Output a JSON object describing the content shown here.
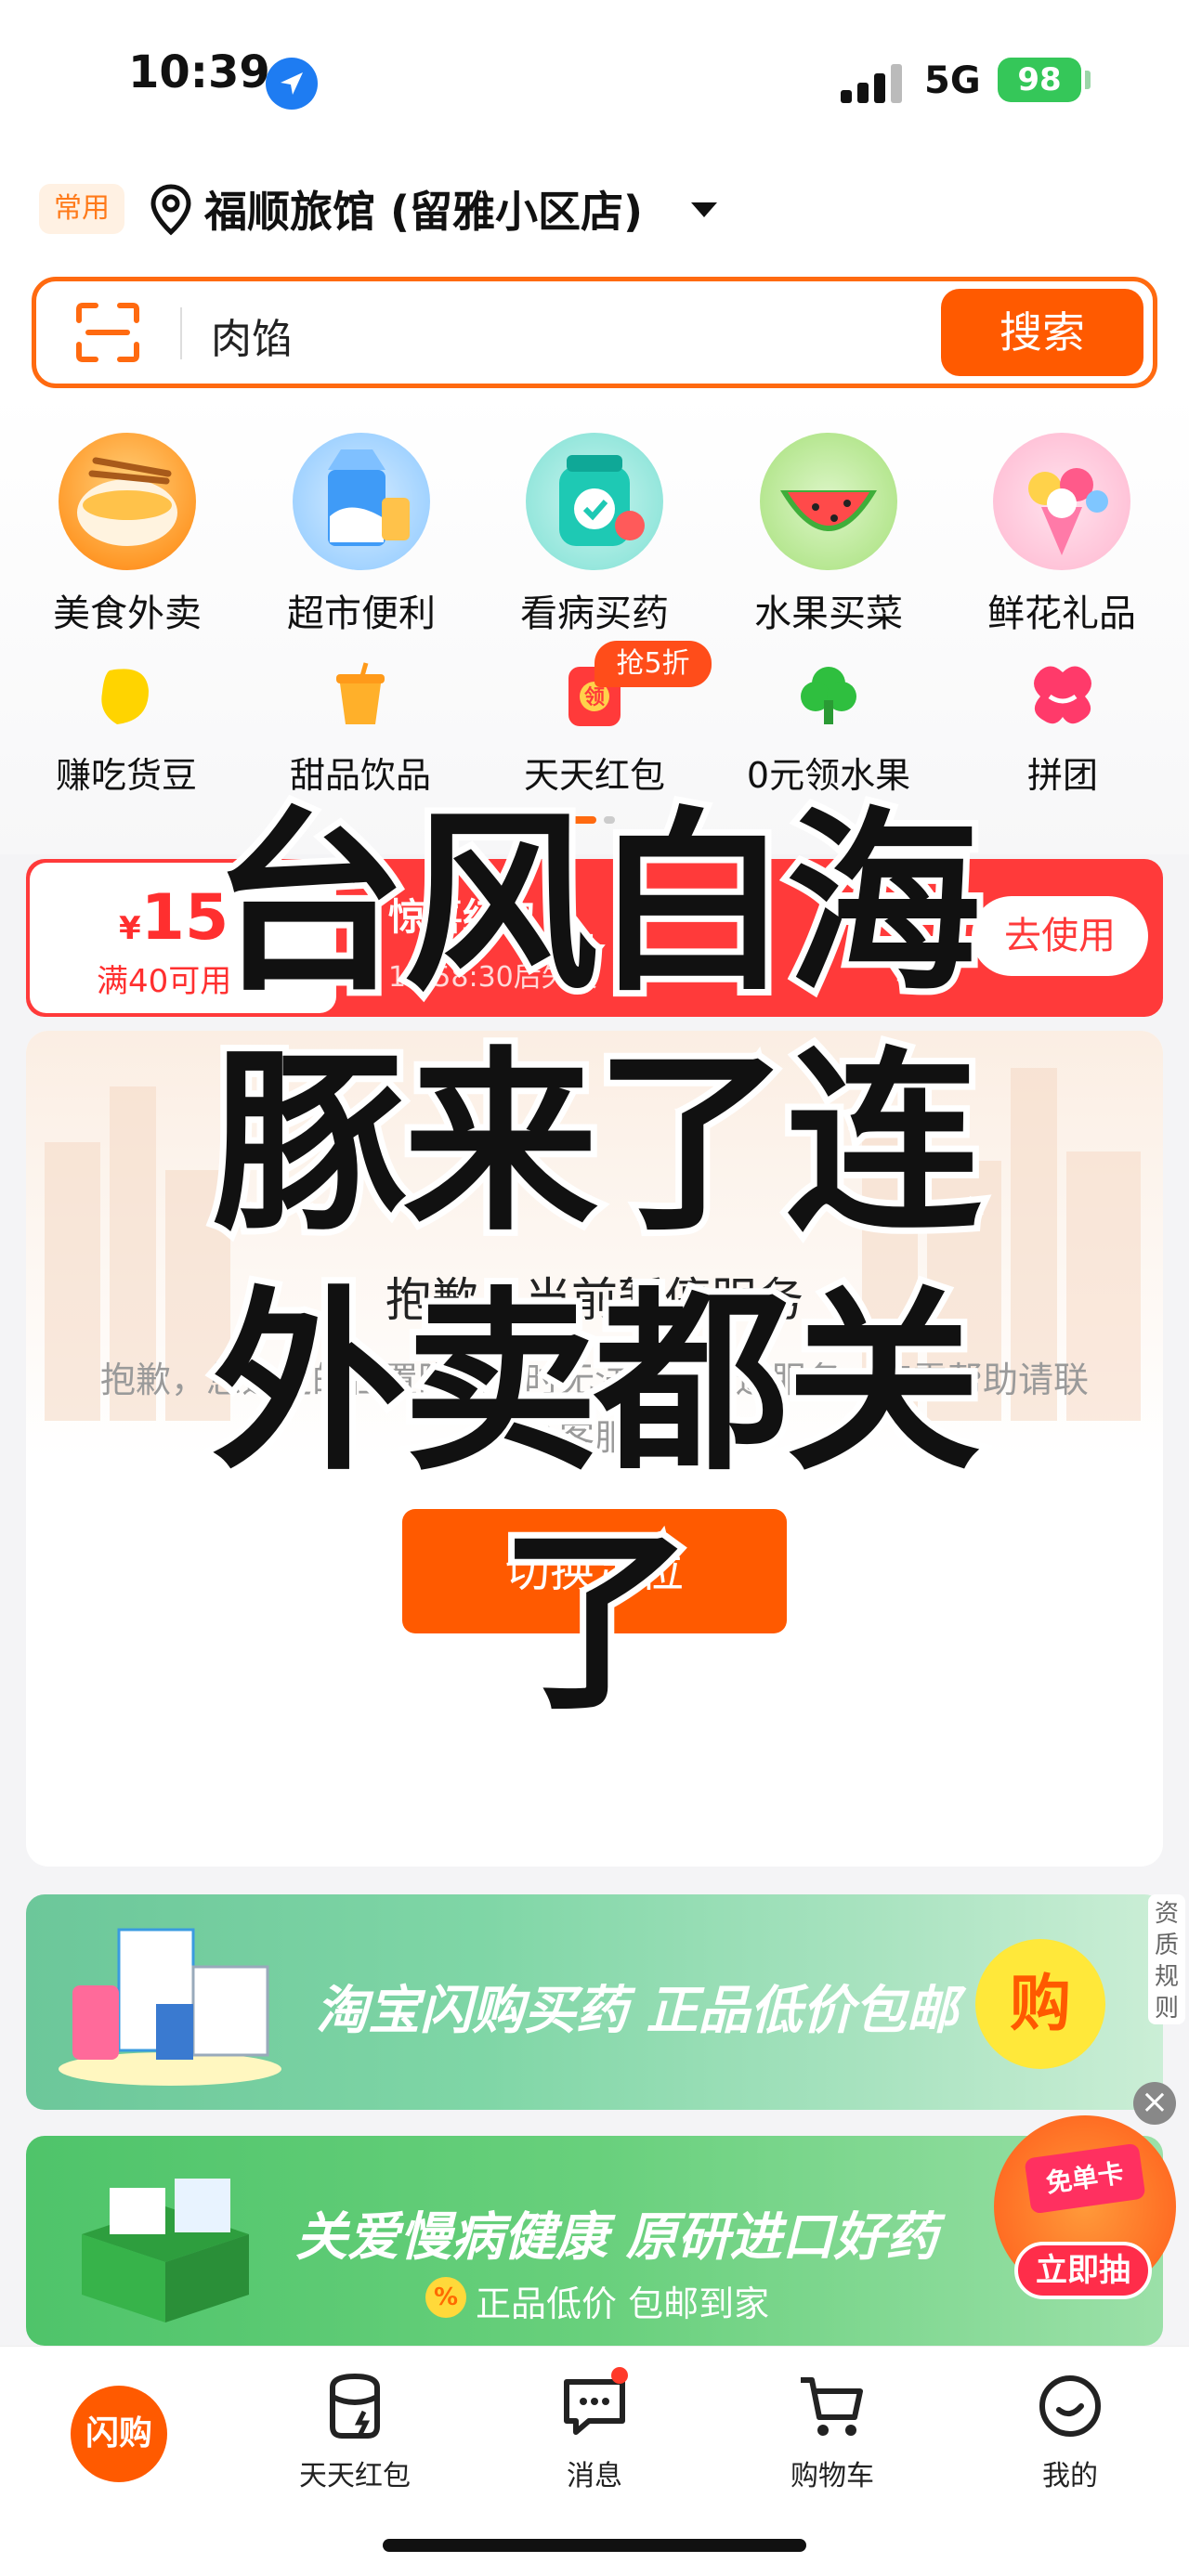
{
  "status_bar": {
    "time": "10:39",
    "network": "5G",
    "battery": "98"
  },
  "location": {
    "tag": "常用",
    "address": "福顺旅馆 (留雅小区店)"
  },
  "search": {
    "query": "肉馅",
    "button": "搜索"
  },
  "categories_main": [
    {
      "label": "美食外卖",
      "icon": "noodle-bowl-icon"
    },
    {
      "label": "超市便利",
      "icon": "milk-carton-icon"
    },
    {
      "label": "看病买药",
      "icon": "medicine-jar-icon"
    },
    {
      "label": "水果买菜",
      "icon": "watermelon-icon"
    },
    {
      "label": "鲜花礼品",
      "icon": "flower-bouquet-icon"
    }
  ],
  "categories_secondary": [
    {
      "label": "赚吃货豆",
      "icon": "bean-icon"
    },
    {
      "label": "甜品饮品",
      "icon": "drink-cup-icon"
    },
    {
      "label": "天天红包",
      "icon": "red-packet-icon"
    },
    {
      "label": "0元领水果",
      "icon": "tree-icon"
    },
    {
      "label": "拼团",
      "icon": "group-icon"
    }
  ],
  "sale_badge": "抢5折",
  "coupon": {
    "currency": "¥",
    "amount": "15",
    "condition": "满40可用",
    "title": "惊喜红包",
    "subtitle": "13:58:30后失效",
    "use_button": "去使用"
  },
  "service": {
    "title": "抱歉，当前暂停服务",
    "description": "抱歉，您选定的位置附近暂时无法提供配送服务，如需帮助请联系客服。",
    "switch_button": "切换定位"
  },
  "overlay_title": "台风白海豚来了连外卖都关了",
  "ads": {
    "ad1_text": "淘宝闪购买药 正品低价包邮",
    "ad1_buy": "购",
    "qualification": "资质规则",
    "ad2_main": "关爱慢病健康 原研进口好药",
    "ad2_sub": "正品低价 包邮到家",
    "ad2_pct": "%",
    "free_card": "免单卡",
    "draw_button": "立即抽"
  },
  "tabbar": [
    {
      "label": "闪购",
      "icon": "home-logo-icon"
    },
    {
      "label": "天天红包",
      "icon": "red-packet-cup-icon"
    },
    {
      "label": "消息",
      "icon": "chat-bubble-icon"
    },
    {
      "label": "购物车",
      "icon": "cart-icon"
    },
    {
      "label": "我的",
      "icon": "smile-face-icon"
    }
  ],
  "colors": {
    "accent": "#ff5a00",
    "coupon_red": "#ff3a3a",
    "ad_green": "#6cc79a"
  }
}
